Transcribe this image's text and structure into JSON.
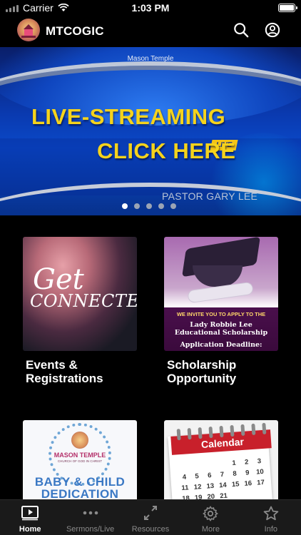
{
  "status_bar": {
    "carrier": "Carrier",
    "time": "1:03 PM"
  },
  "header": {
    "title": "MTCOGIC",
    "icons": [
      "search-icon",
      "account-icon"
    ]
  },
  "banner": {
    "subtitle": "Mason Temple",
    "badge": "LIVE",
    "headline_line1": "LIVE-STREAMING",
    "headline_line2": "CLICK HERE",
    "pastor": "PASTOR GARY LEE",
    "slide_count": 5,
    "active_slide": 1
  },
  "cards": [
    {
      "label": "Events & Registrations",
      "image_text": [
        "Get",
        "CONNECTED"
      ]
    },
    {
      "label": "Scholarship Opportunity",
      "image_text": [
        "WE INVITE YOU TO APPLY TO THE",
        "Lady Robbie Lee Educational Scholarship",
        "Application Deadline:"
      ]
    },
    {
      "label": "",
      "image_text": [
        "MASON TEMPLE",
        "CHURCH OF GOD IN CHRIST",
        "BABY & CHILD",
        "DEDICATION"
      ]
    },
    {
      "label": "",
      "image_text": [
        "Calendar"
      ]
    }
  ],
  "calendar_numbers": [
    "1",
    "2",
    "3",
    "4",
    "5",
    "6",
    "7",
    "8",
    "9",
    "10",
    "11",
    "12",
    "13",
    "14",
    "15",
    "16",
    "17",
    "18",
    "19",
    "20",
    "21"
  ],
  "tabs": [
    {
      "label": "Home",
      "icon": "play-box-icon",
      "active": true
    },
    {
      "label": "Sermons/Live",
      "icon": "dots-icon",
      "active": false
    },
    {
      "label": "Resources",
      "icon": "arrows-icon",
      "active": false
    },
    {
      "label": "More",
      "icon": "gear-icon",
      "active": false
    },
    {
      "label": "Info",
      "icon": "star-icon",
      "active": false
    }
  ]
}
